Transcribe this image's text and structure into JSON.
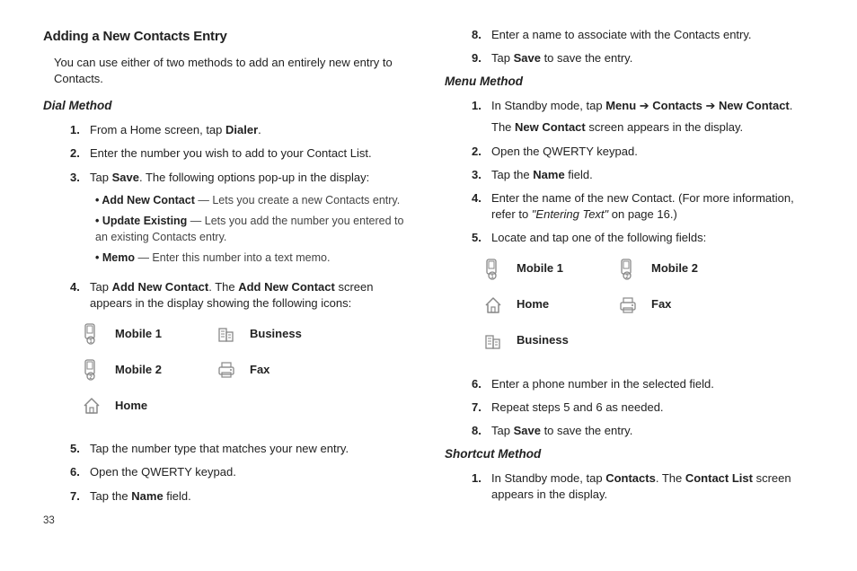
{
  "left": {
    "title": "Adding a New Contacts Entry",
    "intro": "You can use either of two methods to add an entirely new entry to Contacts.",
    "dial_method_heading": "Dial Method",
    "steps": {
      "s1": {
        "num": "1.",
        "pre": "From a Home screen, tap ",
        "bold": "Dialer",
        "post": "."
      },
      "s2": {
        "num": "2.",
        "text": "Enter the number you wish to add to your Contact List."
      },
      "s3": {
        "num": "3.",
        "pre": "Tap ",
        "bold": "Save",
        "post": ". The following options pop-up in the display:"
      },
      "s3b": {
        "b1": {
          "bold": "Add New Contact",
          "rest": " — Lets you create a new Contacts entry."
        },
        "b2": {
          "bold": "Update Existing",
          "rest": " — Lets you add the number you entered to an existing Contacts entry."
        },
        "b3": {
          "bold": "Memo",
          "rest": " — Enter this number into a text memo."
        }
      },
      "s4": {
        "num": "4.",
        "pre": "Tap ",
        "bold1": "Add New Contact",
        "mid": ". The ",
        "bold2": "Add New Contact",
        "post": " screen appears in the display showing the following icons:"
      },
      "icons": {
        "mobile1": "Mobile 1",
        "business": "Business",
        "mobile2": "Mobile 2",
        "fax": "Fax",
        "home": "Home"
      },
      "s5": {
        "num": "5.",
        "text": "Tap the number type that matches your new entry."
      },
      "s6": {
        "num": "6.",
        "text": "Open the QWERTY keypad."
      },
      "s7": {
        "num": "7.",
        "pre": "Tap the ",
        "bold": "Name",
        "post": " field."
      }
    },
    "page_num": "33"
  },
  "right": {
    "steps_cont": {
      "s8": {
        "num": "8.",
        "text": "Enter a name to associate with the Contacts entry."
      },
      "s9": {
        "num": "9.",
        "pre": "Tap ",
        "bold": "Save",
        "post": " to save the entry."
      }
    },
    "menu_method_heading": "Menu Method",
    "menu_steps": {
      "m1": {
        "num": "1.",
        "pre": "In Standby mode, tap ",
        "b1": "Menu",
        "a1": " ➔ ",
        "b2": "Contacts",
        "a2": " ➔ ",
        "b3": "New Contact",
        "post": ".",
        "line2a": "The ",
        "line2b": "New Contact",
        "line2c": " screen appears in the display."
      },
      "m2": {
        "num": "2.",
        "text": "Open the QWERTY keypad."
      },
      "m3": {
        "num": "3.",
        "pre": "Tap the ",
        "bold": "Name",
        "post": " field."
      },
      "m4": {
        "num": "4.",
        "pre": "Enter the name of the new Contact. (For more information, refer to ",
        "ital": "\"Entering Text\"",
        "post": "  on page 16.)"
      },
      "m5": {
        "num": "5.",
        "text": "Locate and tap one of the following fields:"
      },
      "icons": {
        "mobile1": "Mobile 1",
        "mobile2": "Mobile 2",
        "home": "Home",
        "fax": "Fax",
        "business": "Business"
      },
      "m6": {
        "num": "6.",
        "text": "Enter a phone number in the selected field."
      },
      "m7": {
        "num": "7.",
        "text": "Repeat steps 5 and 6 as needed."
      },
      "m8": {
        "num": "8.",
        "pre": "Tap ",
        "bold": "Save",
        "post": " to save the entry."
      }
    },
    "shortcut_heading": "Shortcut Method",
    "shortcut_steps": {
      "sc1": {
        "num": "1.",
        "pre": "In Standby mode, tap ",
        "b1": "Contacts",
        "mid": ". The ",
        "b2": "Contact List",
        "post": " screen appears in the display."
      }
    }
  }
}
